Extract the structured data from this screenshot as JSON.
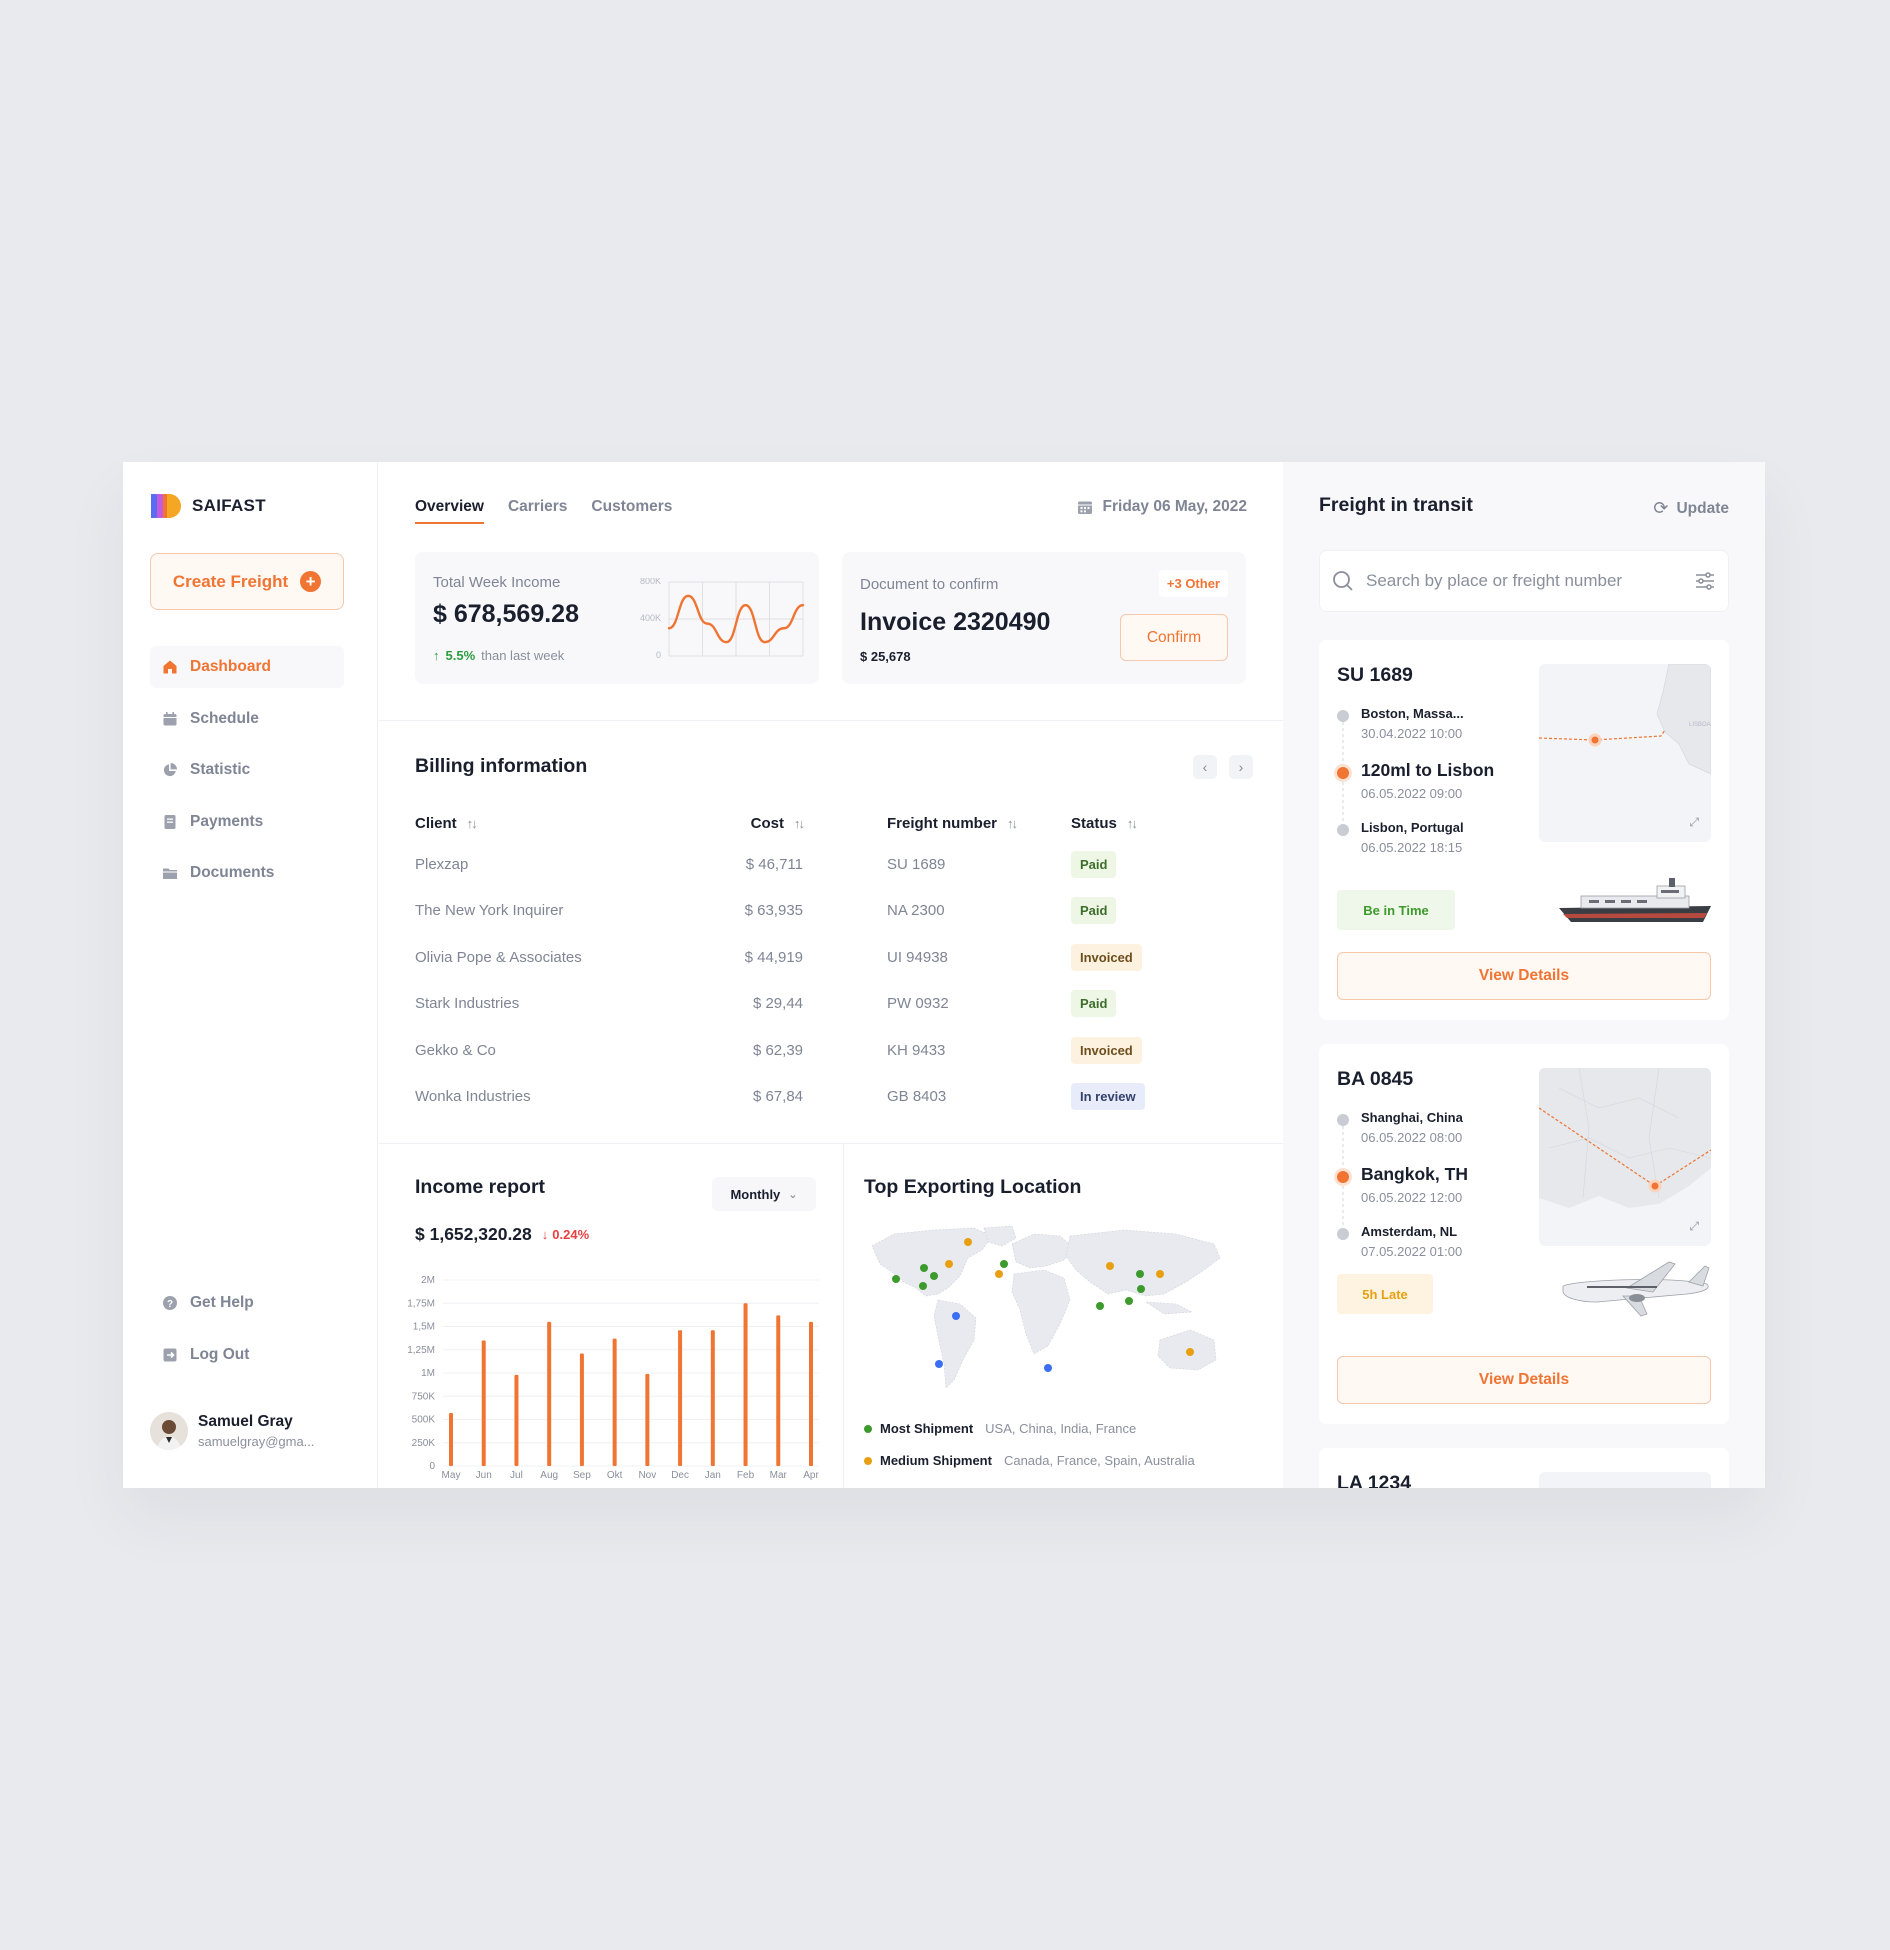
{
  "app": {
    "name": "SAIFAST"
  },
  "sidebar": {
    "create_label": "Create Freight",
    "items": [
      {
        "label": "Dashboard",
        "icon": "home-icon"
      },
      {
        "label": "Schedule",
        "icon": "calendar-icon"
      },
      {
        "label": "Statistic",
        "icon": "pie-chart-icon"
      },
      {
        "label": "Payments",
        "icon": "receipt-icon"
      },
      {
        "label": "Documents",
        "icon": "folder-icon"
      }
    ],
    "bottom_items": [
      {
        "label": "Get Help",
        "icon": "help-icon"
      },
      {
        "label": "Log Out",
        "icon": "logout-icon"
      }
    ],
    "user": {
      "name": "Samuel Gray",
      "email": "samuelgray@gma..."
    }
  },
  "header": {
    "tabs": [
      "Overview",
      "Carriers",
      "Customers"
    ],
    "date": "Friday 06 May, 2022"
  },
  "income_card": {
    "label": "Total Week Income",
    "value": "$ 678,569.28",
    "change": "5.5%",
    "change_text": "than last week",
    "y_ticks": [
      "800K",
      "400K",
      "0"
    ]
  },
  "doc_card": {
    "label": "Document to confirm",
    "other": "+3 Other",
    "title": "Invoice 2320490",
    "amount": "$ 25,678",
    "confirm_label": "Confirm"
  },
  "billing": {
    "title": "Billing information",
    "columns": [
      "Client",
      "Cost",
      "Freight number",
      "Status"
    ],
    "rows": [
      {
        "client": "Plexzap",
        "cost": "$ 46,711",
        "freight": "SU 1689",
        "status": "Paid"
      },
      {
        "client": "The New York Inquirer",
        "cost": "$ 63,935",
        "freight": "NA 2300",
        "status": "Paid"
      },
      {
        "client": "Olivia Pope & Associates",
        "cost": "$ 44,919",
        "freight": "UI 94938",
        "status": "Invoiced"
      },
      {
        "client": "Stark Industries",
        "cost": "$ 29,44",
        "freight": "PW 0932",
        "status": "Paid"
      },
      {
        "client": "Gekko & Co",
        "cost": "$ 62,39",
        "freight": "KH 9433",
        "status": "Invoiced"
      },
      {
        "client": "Wonka Industries",
        "cost": "$ 67,84",
        "freight": "GB 8403",
        "status": "In review"
      }
    ]
  },
  "income_report": {
    "title": "Income report",
    "period": "Monthly",
    "total": "$ 1,652,320.28",
    "change": "0.24%"
  },
  "top_export": {
    "title": "Top Exporting Location",
    "legend": [
      {
        "label": "Most Shipment",
        "detail": "USA, China, India, France",
        "color": "#3d9a2c"
      },
      {
        "label": "Medium Shipment",
        "detail": "Canada, France, Spain, Australia",
        "color": "#e8a012"
      }
    ]
  },
  "transit": {
    "title": "Freight in transit",
    "update_label": "Update",
    "search_placeholder": "Search by place or freight number",
    "view_label": "View Details",
    "freights": [
      {
        "code": "SU 1689",
        "stops": [
          {
            "place": "Boston,  Massa...",
            "time": "30.04.2022 10:00"
          },
          {
            "place": "120ml to Lisbon",
            "time": "06.05.2022 09:00"
          },
          {
            "place": "Lisbon, Portugal",
            "time": "06.05.2022 18:15"
          }
        ],
        "status": "Be in Time",
        "map_label": "LISBOA",
        "vehicle": "ship"
      },
      {
        "code": "BA 0845",
        "stops": [
          {
            "place": "Shanghai, China",
            "time": "06.05.2022 08:00"
          },
          {
            "place": "Bangkok, TH",
            "time": "06.05.2022 12:00"
          },
          {
            "place": "Amsterdam, NL",
            "time": "07.05.2022 01:00"
          }
        ],
        "status": "5h Late",
        "vehicle": "plane"
      },
      {
        "code": "LA 1234"
      }
    ]
  },
  "colors": {
    "accent": "#f07432",
    "success": "#2a9d3f",
    "danger": "#e94141"
  },
  "chart_data": [
    {
      "type": "line",
      "title": "",
      "y_ticks": [
        "800K",
        "400K",
        "0"
      ],
      "ylim": [
        0,
        800000
      ],
      "series": [
        {
          "values": [
            300000,
            650000,
            350000,
            150000,
            550000,
            150000,
            300000,
            550000
          ]
        }
      ]
    },
    {
      "type": "bar",
      "title": "Income report",
      "categories": [
        "May",
        "Jun",
        "Jul",
        "Aug",
        "Sep",
        "Okt",
        "Nov",
        "Dec",
        "Jan",
        "Feb",
        "Mar",
        "Apr"
      ],
      "values": [
        570000,
        1350000,
        980000,
        1550000,
        1210000,
        1370000,
        990000,
        1460000,
        1460000,
        1750000,
        1620000,
        1550000
      ],
      "y_ticks": [
        "2M",
        "1,75M",
        "1,5M",
        "1,25M",
        "1M",
        "750K",
        "500K",
        "250K",
        "0"
      ],
      "ylim": [
        0,
        2000000
      ]
    }
  ]
}
